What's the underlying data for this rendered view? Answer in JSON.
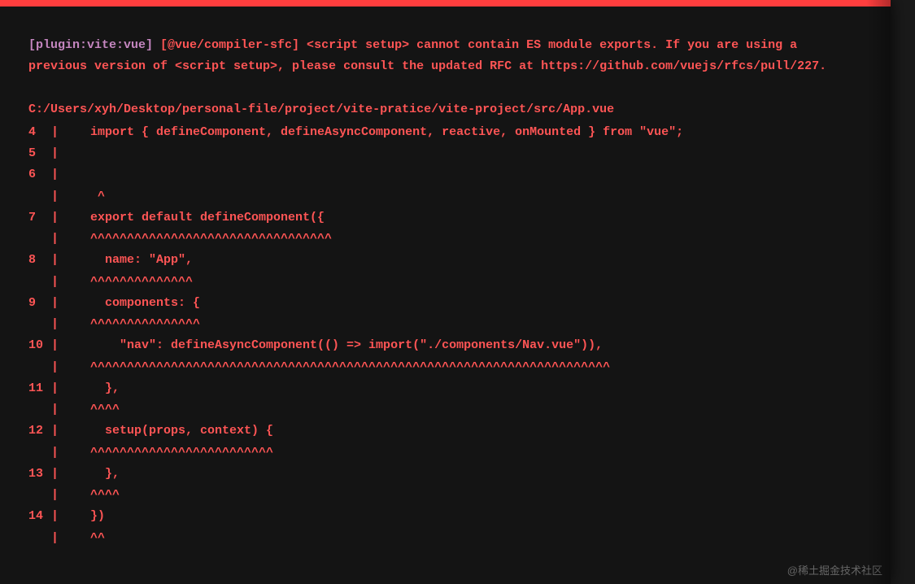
{
  "error": {
    "plugin_tag": "[plugin:vite:vue]",
    "message": " [@vue/compiler-sfc] <script setup> cannot contain ES module exports. If you are using a previous version of <script setup>, please consult the updated RFC at https://github.com/vuejs/rfcs/pull/227.",
    "file_path": "C:/Users/xyh/Desktop/personal-file/project/vite-pratice/vite-project/src/App.vue",
    "lines": [
      {
        "num": "4",
        "pipe": "|",
        "code": "  import { defineComponent, defineAsyncComponent, reactive, onMounted } from \"vue\";"
      },
      {
        "num": "5",
        "pipe": "|",
        "code": ""
      },
      {
        "num": "6",
        "pipe": "|",
        "code": ""
      },
      {
        "num": "",
        "pipe": "|",
        "code": "   ^"
      },
      {
        "num": "7",
        "pipe": "|",
        "code": "  export default defineComponent({"
      },
      {
        "num": "",
        "pipe": "|",
        "code": "  ^^^^^^^^^^^^^^^^^^^^^^^^^^^^^^^^^"
      },
      {
        "num": "8",
        "pipe": "|",
        "code": "    name: \"App\","
      },
      {
        "num": "",
        "pipe": "|",
        "code": "  ^^^^^^^^^^^^^^"
      },
      {
        "num": "9",
        "pipe": "|",
        "code": "    components: {"
      },
      {
        "num": "",
        "pipe": "|",
        "code": "  ^^^^^^^^^^^^^^^"
      },
      {
        "num": "10",
        "pipe": "|",
        "code": "      \"nav\": defineAsyncComponent(() => import(\"./components/Nav.vue\")),"
      },
      {
        "num": "",
        "pipe": "|",
        "code": "  ^^^^^^^^^^^^^^^^^^^^^^^^^^^^^^^^^^^^^^^^^^^^^^^^^^^^^^^^^^^^^^^^^^^^^^^"
      },
      {
        "num": "11",
        "pipe": "|",
        "code": "    },"
      },
      {
        "num": "",
        "pipe": "|",
        "code": "  ^^^^"
      },
      {
        "num": "12",
        "pipe": "|",
        "code": "    setup(props, context) {"
      },
      {
        "num": "",
        "pipe": "|",
        "code": "  ^^^^^^^^^^^^^^^^^^^^^^^^^"
      },
      {
        "num": "13",
        "pipe": "|",
        "code": "    },"
      },
      {
        "num": "",
        "pipe": "|",
        "code": "  ^^^^"
      },
      {
        "num": "14",
        "pipe": "|",
        "code": "  })"
      },
      {
        "num": "",
        "pipe": "|",
        "code": "  ^^"
      }
    ]
  },
  "watermark": "@稀土掘金技术社区"
}
